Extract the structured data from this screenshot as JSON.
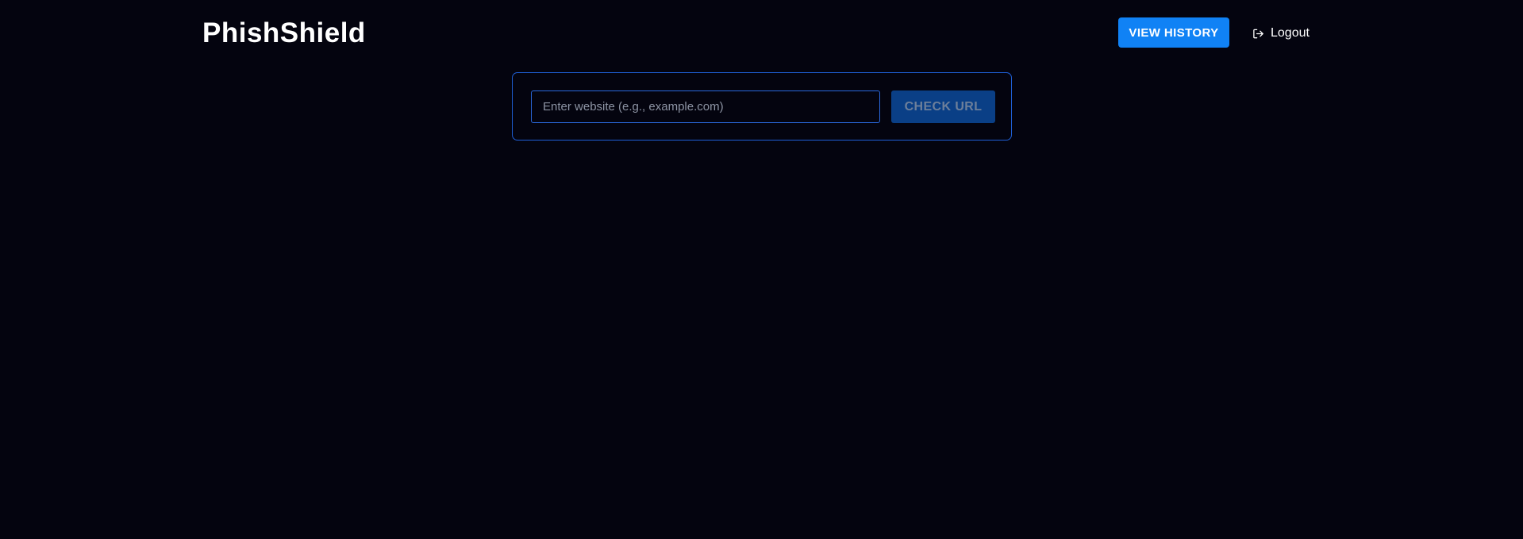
{
  "header": {
    "brand": "PhishShield",
    "view_history_label": "VIEW HISTORY",
    "logout_label": "Logout",
    "logout_icon": "logout-icon"
  },
  "checker": {
    "url_input_placeholder": "Enter website (e.g., example.com)",
    "url_input_value": "",
    "check_button_label": "CHECK URL",
    "check_button_disabled": true
  },
  "colors": {
    "background": "#04040f",
    "accent": "#1082f5",
    "panel_border": "#1f5fd6",
    "disabled_button": "#0a3f86"
  }
}
